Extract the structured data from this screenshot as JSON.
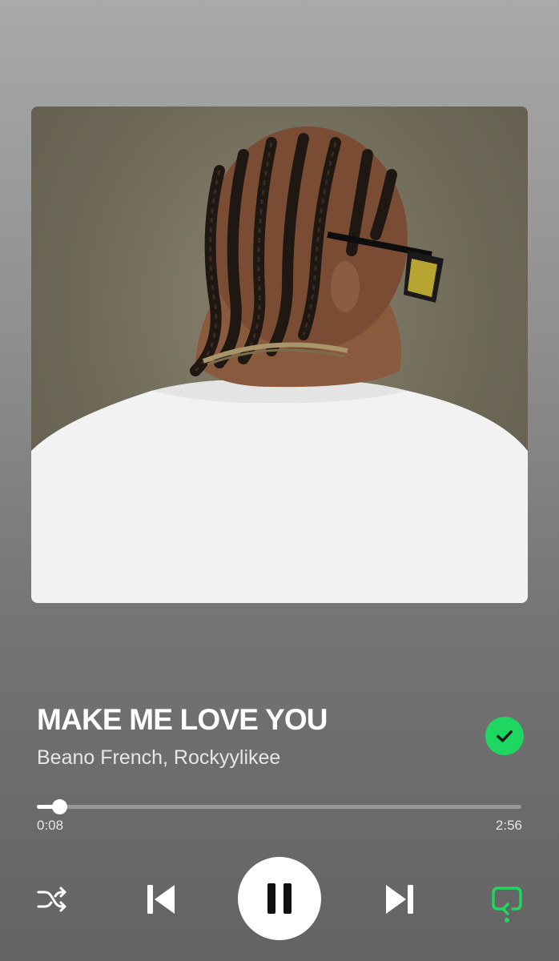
{
  "track": {
    "title": "MAKE ME LOVE YOU",
    "artists": "Beano French, Rockyylikee",
    "liked": true
  },
  "progress": {
    "elapsed": "0:08",
    "duration": "2:56",
    "fraction": 0.0455
  },
  "controls": {
    "shuffle_icon": "shuffle-icon",
    "previous_icon": "skip-previous-icon",
    "play_pause_icon": "pause-icon",
    "next_icon": "skip-next-icon",
    "repeat_icon": "repeat-icon"
  },
  "colors": {
    "accent_green": "#1ed760",
    "white": "#ffffff"
  }
}
